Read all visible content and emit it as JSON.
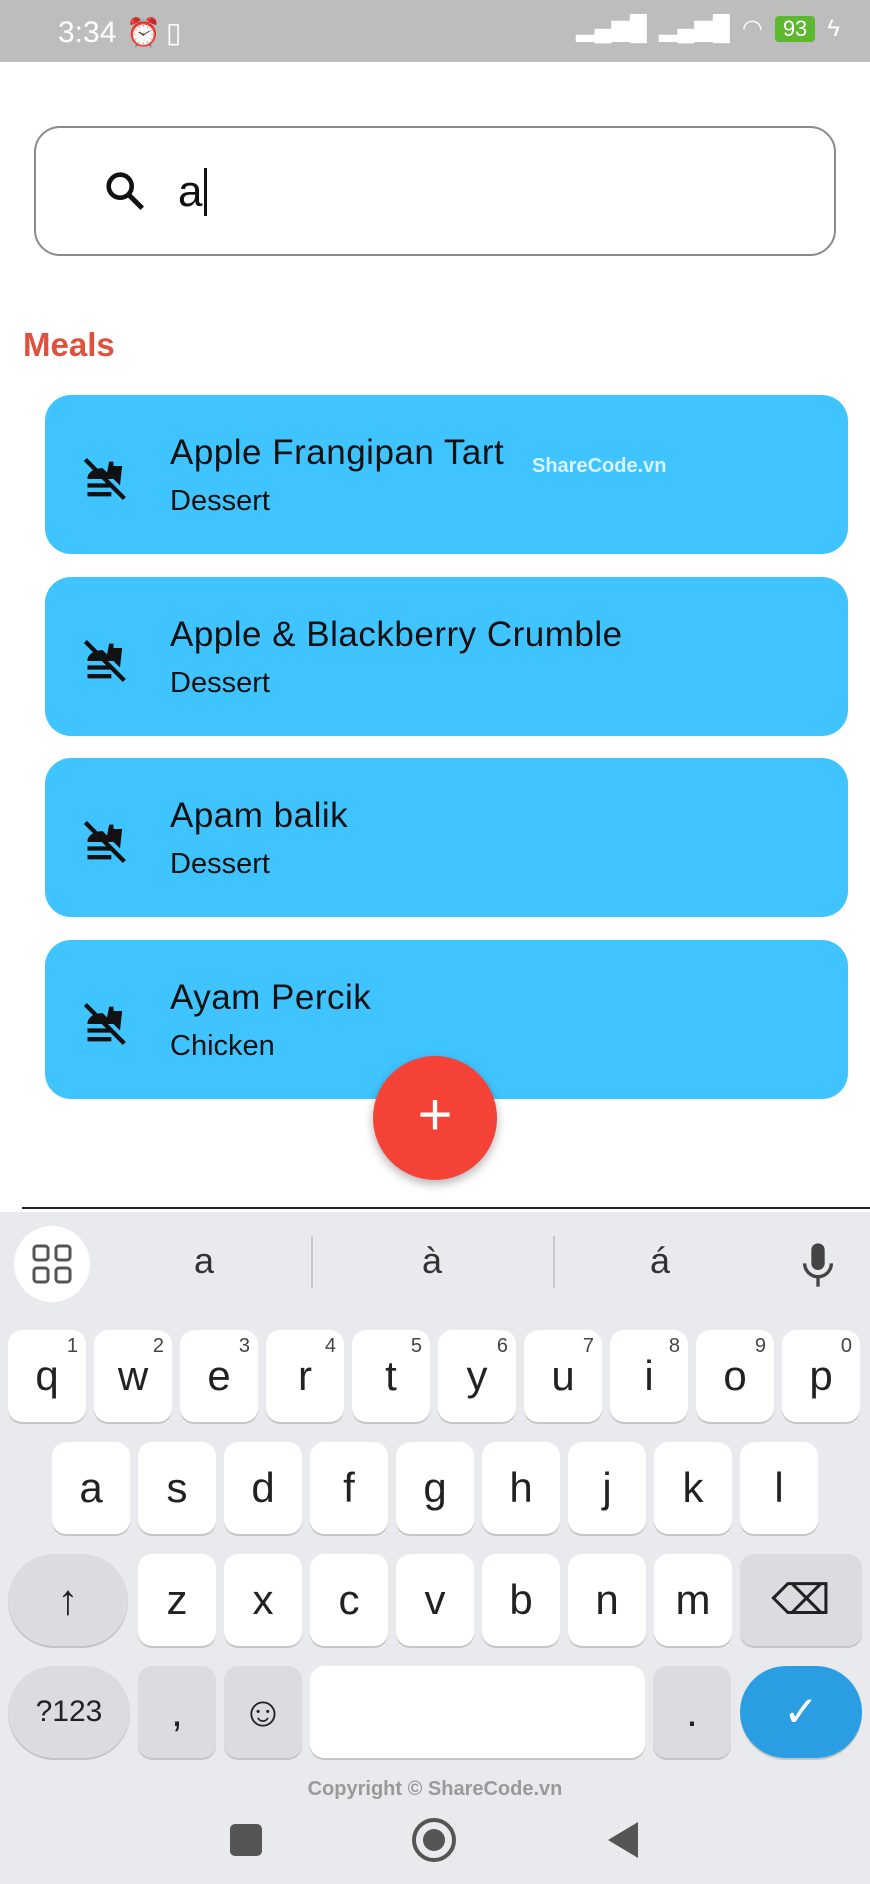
{
  "status": {
    "time": "3:34",
    "battery": "93",
    "watermark_logo": "SHARECODE.vn"
  },
  "search": {
    "value": "a",
    "icon": "search-icon"
  },
  "section_title": "Meals",
  "meals": [
    {
      "name": "Apple Frangipan Tart",
      "category": "Dessert"
    },
    {
      "name": "Apple & Blackberry Crumble",
      "category": "Dessert"
    },
    {
      "name": "Apam balik",
      "category": "Dessert"
    },
    {
      "name": "Ayam Percik",
      "category": "Chicken"
    }
  ],
  "card_icon": "no-food-icon",
  "card_color": "#40c4ff",
  "fab_color": "#f44336",
  "watermark": "ShareCode.vn",
  "keyboard": {
    "suggestions": [
      "a",
      "à",
      "á"
    ],
    "row1": [
      "q",
      "w",
      "e",
      "r",
      "t",
      "y",
      "u",
      "i",
      "o",
      "p"
    ],
    "row1_hints": [
      "1",
      "2",
      "3",
      "4",
      "5",
      "6",
      "7",
      "8",
      "9",
      "0"
    ],
    "row2": [
      "a",
      "s",
      "d",
      "f",
      "g",
      "h",
      "j",
      "k",
      "l"
    ],
    "row3": [
      "z",
      "x",
      "c",
      "v",
      "b",
      "n",
      "m"
    ],
    "symbols": "?123",
    "comma": ",",
    "period": "."
  },
  "copyright": "Copyright © ShareCode.vn"
}
